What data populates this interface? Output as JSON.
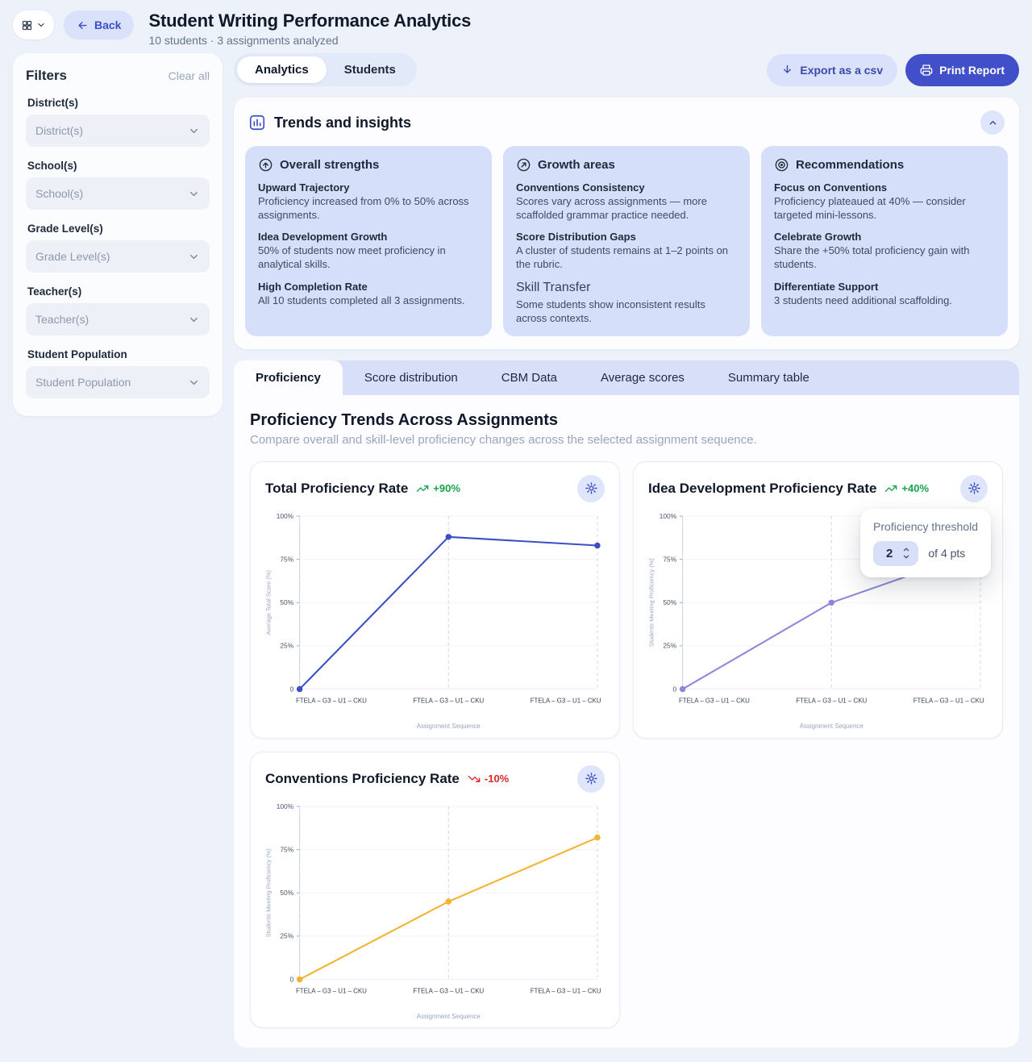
{
  "header": {
    "back_label": "Back",
    "title": "Student Writing Performance Analytics",
    "subtitle": "10 students · 3 assignments analyzed"
  },
  "filters": {
    "title": "Filters",
    "clear_label": "Clear all",
    "groups": [
      {
        "label": "District(s)",
        "placeholder": "District(s)"
      },
      {
        "label": "School(s)",
        "placeholder": "School(s)"
      },
      {
        "label": "Grade Level(s)",
        "placeholder": "Grade Level(s)"
      },
      {
        "label": "Teacher(s)",
        "placeholder": "Teacher(s)"
      },
      {
        "label": "Student Population",
        "placeholder": "Student Population"
      }
    ]
  },
  "view_tabs": [
    {
      "label": "Analytics",
      "active": true
    },
    {
      "label": "Students",
      "active": false
    }
  ],
  "actions": {
    "export_label": "Export as a csv",
    "print_label": "Print Report"
  },
  "trends": {
    "title": "Trends and insights",
    "cards": [
      {
        "title": "Overall strengths",
        "items": [
          {
            "title": "Upward Trajectory",
            "desc": "Proficiency increased from 0% to 50% across assignments."
          },
          {
            "title": "Idea Development Growth",
            "desc": "50% of students now meet proficiency in analytical skills."
          },
          {
            "title": "High Completion Rate",
            "desc": "All 10 students completed all 3 assignments."
          }
        ]
      },
      {
        "title": "Growth areas",
        "items": [
          {
            "title": "Conventions Consistency",
            "desc": "Scores vary across assignments — more scaffolded grammar practice needed."
          },
          {
            "title": "Score Distribution Gaps",
            "desc": "A cluster of students remains at 1–2 points on the rubric."
          },
          {
            "title": "Skill Transfer",
            "desc": "Some students show inconsistent results across contexts."
          }
        ]
      },
      {
        "title": "Recommendations",
        "items": [
          {
            "title": "Focus on Conventions",
            "desc": "Proficiency plateaued at 40% — consider targeted mini-lessons."
          },
          {
            "title": "Celebrate Growth",
            "desc": "Share the +50% total proficiency gain with students."
          },
          {
            "title": "Differentiate Support",
            "desc": "3 students need additional scaffolding."
          }
        ]
      }
    ]
  },
  "chart_tabs": [
    {
      "label": "Proficiency",
      "active": true
    },
    {
      "label": "Score distribution",
      "active": false
    },
    {
      "label": "CBM Data",
      "active": false
    },
    {
      "label": "Average scores",
      "active": false
    },
    {
      "label": "Summary table",
      "active": false
    }
  ],
  "section": {
    "title": "Proficiency Trends Across Assignments",
    "subtitle": "Compare overall and skill-level proficiency changes across the selected assignment sequence."
  },
  "threshold_popover": {
    "title": "Proficiency threshold",
    "value": "2",
    "suffix": "of 4 pts"
  },
  "chart_data": [
    {
      "type": "line",
      "title": "Total Proficiency Rate",
      "trend": "+90%",
      "trend_dir": "up",
      "color": "#3b4ec4",
      "ylabel": "Average Total Score (%)",
      "xlabel": "Assignment Sequence",
      "x": [
        "FTELA – G3 – U1 – CKU",
        "FTELA – G3 – U1 – CKU",
        "FTELA – G3 – U1 – CKU"
      ],
      "values": [
        0,
        88,
        83
      ],
      "ylim": [
        0,
        100
      ],
      "yticks": [
        [
          0,
          "0"
        ],
        [
          25,
          "25%"
        ],
        [
          50,
          "50%"
        ],
        [
          75,
          "75%"
        ],
        [
          100,
          "100%"
        ]
      ]
    },
    {
      "type": "line",
      "title": "Idea Development Proficiency Rate",
      "trend": "+40%",
      "trend_dir": "up",
      "color": "#8b87da",
      "ylabel": "Students Meeting Proficiency (%)",
      "xlabel": "Assignment Sequence",
      "x": [
        "FTELA – G3 – U1 – CKU",
        "FTELA – G3 – U1 – CKU",
        "FTELA – G3 – U1 – CKU"
      ],
      "values": [
        0,
        50,
        80
      ],
      "ylim": [
        0,
        100
      ],
      "yticks": [
        [
          0,
          "0"
        ],
        [
          25,
          "25%"
        ],
        [
          50,
          "50%"
        ],
        [
          75,
          "75%"
        ],
        [
          100,
          "100%"
        ]
      ]
    },
    {
      "type": "line",
      "title": "Conventions Proficiency Rate",
      "trend": "-10%",
      "trend_dir": "down",
      "color": "#f2b32e",
      "ylabel": "Students Meeting Proficiency (%)",
      "xlabel": "Assignment Sequence",
      "x": [
        "FTELA – G3 – U1 – CKU",
        "FTELA – G3 – U1 – CKU",
        "FTELA – G3 – U1 – CKU"
      ],
      "values": [
        0,
        45,
        82
      ],
      "ylim": [
        0,
        100
      ],
      "yticks": [
        [
          0,
          "0"
        ],
        [
          25,
          "25%"
        ],
        [
          50,
          "50%"
        ],
        [
          75,
          "75%"
        ],
        [
          100,
          "100%"
        ]
      ]
    }
  ]
}
